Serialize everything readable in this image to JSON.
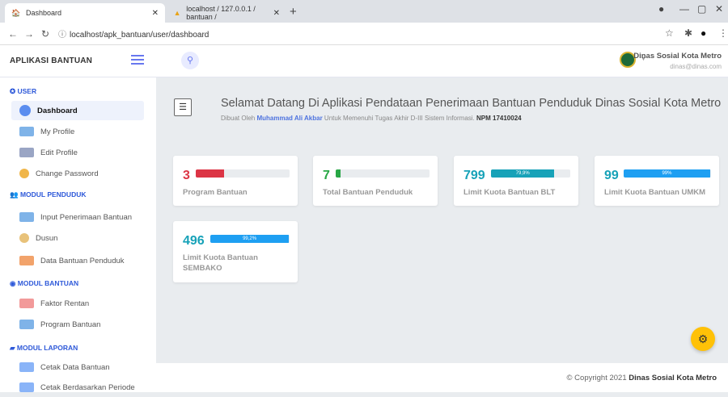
{
  "browser": {
    "tabs": [
      {
        "title": "Dashboard"
      },
      {
        "title": "localhost / 127.0.0.1 / bantuan /"
      }
    ],
    "url": "localhost/apk_bantuan/user/dashboard"
  },
  "topbar": {
    "brand": "APLIKASI BANTUAN",
    "user_name": "Dinas Sosial Kota Metro",
    "user_email": "dinas@dinas.com"
  },
  "sidebar": {
    "sections": [
      {
        "title": "✪ USER",
        "items": [
          "Dashboard",
          "My Profile",
          "Edit Profile",
          "Change Password"
        ]
      },
      {
        "title": "👥 MODUL PENDUDUK",
        "items": [
          "Input Penerimaan Bantuan",
          "Dusun",
          "Data Bantuan Penduduk"
        ]
      },
      {
        "title": "◉ MODUL BANTUAN",
        "items": [
          "Faktor Rentan",
          "Program Bantuan"
        ]
      },
      {
        "title": "▰ MODUL LAPORAN",
        "items": [
          "Cetak Data Bantuan",
          "Cetak Berdasarkan Periode"
        ]
      }
    ]
  },
  "welcome": {
    "title": "Selamat Datang Di Aplikasi Pendataan Penerimaan Bantuan Penduduk Dinas Sosial Kota Metro",
    "sub_prefix": "Dibuat Oleh",
    "author": "Muhammad Ali Akbar",
    "sub_mid": "Untuk Memenuhi Tugas Akhir D-III Sistem Informasi.",
    "npm": "NPM 17410024"
  },
  "cards": [
    {
      "value": "3",
      "label": "Program Bantuan",
      "progress": 0.3,
      "bar_text": "",
      "color": "#dc3545"
    },
    {
      "value": "7",
      "label": "Total Bantuan Penduduk",
      "progress": 0.05,
      "bar_text": "",
      "color": "#28a745"
    },
    {
      "value": "799",
      "label": "Limit Kuota Bantuan BLT",
      "progress": 0.799,
      "bar_text": "79,9%",
      "color": "#17a2b8"
    },
    {
      "value": "99",
      "label": "Limit Kuota Bantuan UMKM",
      "progress": 0.99,
      "bar_text": "99%",
      "color": "#1e9ff2"
    },
    {
      "value": "496",
      "label": "Limit Kuota Bantuan SEMBAKO",
      "progress": 0.992,
      "bar_text": "99,2%",
      "color": "#1e9ff2"
    }
  ],
  "footer": {
    "prefix": "© Copyright 2021",
    "org": "Dinas Sosial Kota Metro"
  },
  "colors": {
    "accent": "#4e73df",
    "fab": "#ffc107"
  }
}
